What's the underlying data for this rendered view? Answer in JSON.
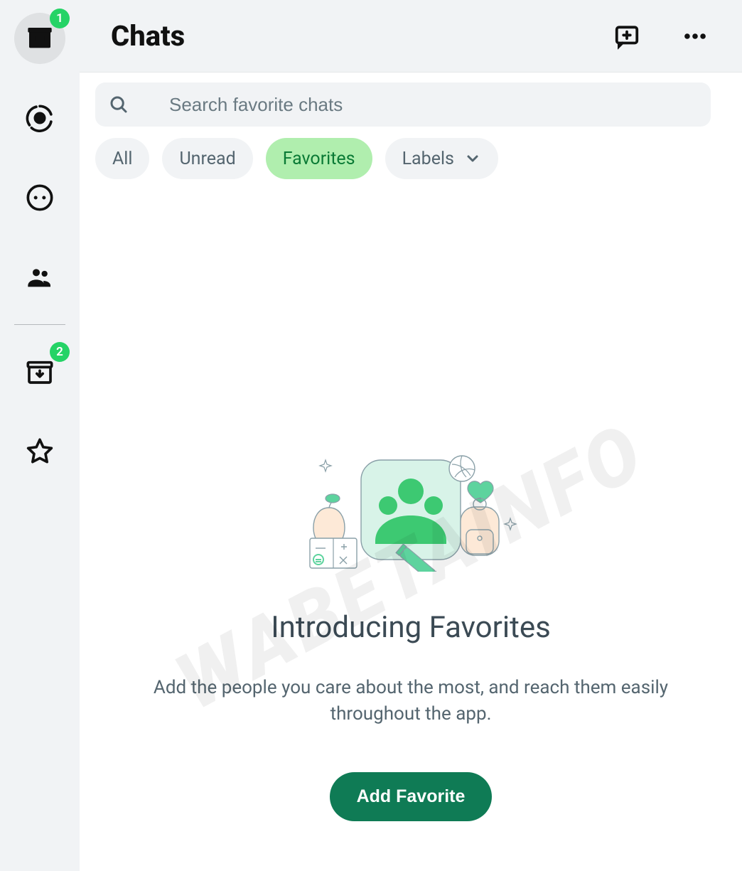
{
  "header": {
    "title": "Chats"
  },
  "sidebar": {
    "items": [
      {
        "name": "chat-icon",
        "badge": "1"
      },
      {
        "name": "status-icon"
      },
      {
        "name": "channels-icon"
      },
      {
        "name": "communities-icon"
      },
      {
        "name": "archived-icon",
        "badge": "2"
      },
      {
        "name": "starred-icon"
      }
    ]
  },
  "search": {
    "placeholder": "Search favorite chats"
  },
  "filters": {
    "all": "All",
    "unread": "Unread",
    "favorites": "Favorites",
    "labels": "Labels"
  },
  "promo": {
    "title": "Introducing Favorites",
    "description": "Add the people you care about the most, and reach them easily throughout the app.",
    "button": "Add Favorite"
  },
  "watermark": "WABETAINFO",
  "colors": {
    "accent": "#25d366",
    "chipActive": "#b0eeae",
    "buttonPrimary": "#0f7b55"
  }
}
